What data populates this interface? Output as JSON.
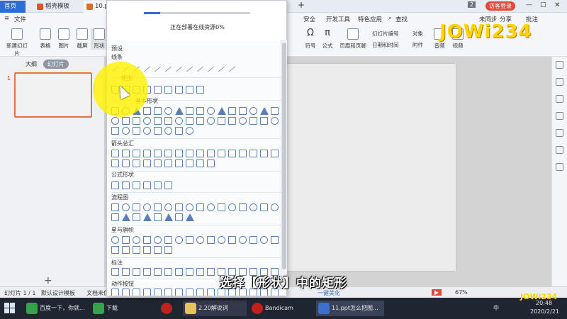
{
  "titlebar": {
    "home_tab": "首页",
    "template_tab": "稻壳模板",
    "doc_tab": "10.ppt",
    "badge": "2",
    "login_btn": "访客登录"
  },
  "ribbon": {
    "menu_file": "文件",
    "tabs": [
      "安全",
      "开发工具",
      "特色应用",
      "查找"
    ],
    "sync": "未同步",
    "share": "分享",
    "comment": "批注",
    "buttons": [
      "新建幻灯片",
      "表格",
      "图片",
      "截屏",
      "形状"
    ],
    "right_buttons": [
      "符号",
      "公式",
      "页眉和页脚",
      "幻灯片编号",
      "日期和时间",
      "对象",
      "附件",
      "音频",
      "视频"
    ]
  },
  "leftpane": {
    "tab_outline": "大纲",
    "tab_slides": "幻灯片",
    "slide_number": "1",
    "add_slide": "+"
  },
  "shape_menu": {
    "loading_text": "正在部署在线资源0%",
    "progress": 0.15,
    "preset": "预设",
    "sections": [
      "线条",
      "矩形",
      "基本形状",
      "箭头总汇",
      "公式形状",
      "流程图",
      "星与旗帜",
      "标注",
      "动作按钮"
    ]
  },
  "statusbar": {
    "slide_info": "幻灯片 1 / 1",
    "design": "默认设计模板",
    "text_note": "文档未保",
    "beautify": "一键美化",
    "zoom": "67%"
  },
  "taskbar": {
    "items": [
      "百度一下，你就...",
      "下载",
      "",
      "2.20解说词",
      "Bandicam",
      "11.ppt怎么把图..."
    ],
    "time": "20:48",
    "date": "2020/2/21",
    "ime": "中"
  },
  "overlay": {
    "subtitle": "选择【形状】中的矩形",
    "watermark": "JOWi234",
    "watermark_small": "JOWi234"
  },
  "colors": {
    "accent": "#2b6fd6",
    "highlight": "#fff000",
    "shape_stroke": "#5b7fb5"
  }
}
